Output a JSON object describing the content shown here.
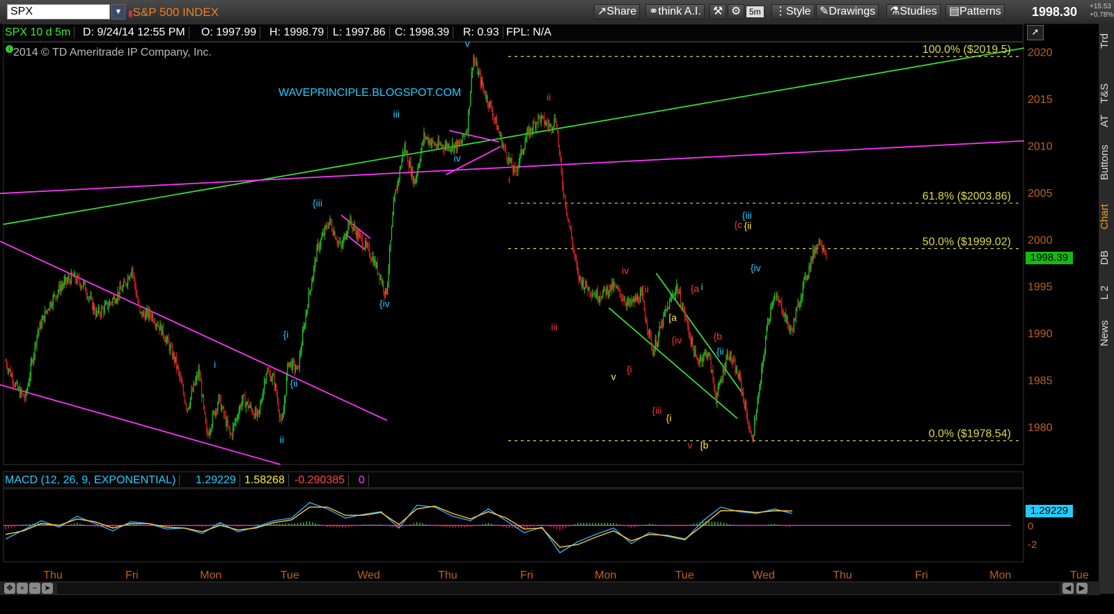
{
  "toolbar": {
    "symbol": "SPX",
    "symbol_name": "S&P 500 INDEX",
    "buttons": [
      "Share",
      "think A.I.",
      "5m",
      "Style",
      "Drawings",
      "Studies",
      "Patterns"
    ],
    "last_price": "1998.30",
    "change_abs": "+15.53",
    "change_pct": "+0.78%"
  },
  "sidebar_tabs": [
    "Trd",
    "T&S",
    "AT",
    "Buttons",
    "Chart",
    "DB",
    "L 2",
    "News"
  ],
  "infobar": {
    "label": "SPX 10 d 5m",
    "date": "D: 9/24/14 12:55 PM",
    "open": "O: 1997.99",
    "high": "H: 1998.79",
    "low": "L: 1997.86",
    "close": "C: 1998.39",
    "range": "R: 0.93",
    "fpl": "FPL: N/A"
  },
  "copyright": "2014 © TD Ameritrade IP Company, Inc.",
  "watermark": "WAVEPRINCIPLE.BLOGSPOT.COM",
  "price_badge": "1998.39",
  "macd_badge": "1.29229",
  "macd": {
    "label": "MACD (12, 26, 9, EXPONENTIAL)",
    "value": "1.29229",
    "avg": "1.58268",
    "diff": "-0.290385",
    "zero": "0"
  },
  "fib_levels": [
    {
      "label": "100.0%  ($2019.5)",
      "price": 2019.5
    },
    {
      "label": "61.8%  ($2003.86)",
      "price": 2003.86
    },
    {
      "label": "50.0%  ($1999.02)",
      "price": 1999.02
    },
    {
      "label": "0.0%  ($1978.54)",
      "price": 1978.54
    }
  ],
  "colors": {
    "up": "#22cc22",
    "down": "#dd2222",
    "green_line": "#33dd33",
    "magenta_line": "#ff33ff",
    "fib": "#dddd44",
    "cyan": "#22ccff",
    "red": "#ff3333",
    "yellow": "#ffee33",
    "axis": "#c06020"
  },
  "chart_data": {
    "type": "candlestick",
    "title": "SPX 10 d 5m",
    "ylim": [
      1976,
      2021
    ],
    "y_ticks": [
      1980,
      1985,
      1990,
      1995,
      2000,
      2005,
      2010,
      2015,
      2020
    ],
    "x_ticks": [
      "Thu",
      "Fri",
      "Mon",
      "Tue",
      "Wed",
      "Thu",
      "Fri",
      "Mon",
      "Tue",
      "Wed",
      "Thu",
      "Fri",
      "Mon",
      "Tue"
    ],
    "x_tick_session": [
      0.6,
      1.6,
      2.6,
      3.6,
      4.6,
      5.6,
      6.6,
      7.6,
      8.6,
      9.6,
      10.6,
      11.6,
      12.6,
      13.6
    ],
    "last_price": 1998.39,
    "price_path": [
      [
        0.0,
        1987
      ],
      [
        0.15,
        1984
      ],
      [
        0.25,
        1983
      ],
      [
        0.4,
        1990
      ],
      [
        0.55,
        1993
      ],
      [
        0.7,
        1995
      ],
      [
        0.85,
        1996
      ],
      [
        1.0,
        1995
      ],
      [
        1.15,
        1992
      ],
      [
        1.3,
        1993
      ],
      [
        1.5,
        1995
      ],
      [
        1.6,
        1997
      ],
      [
        1.7,
        1992
      ],
      [
        1.85,
        1992
      ],
      [
        2.0,
        1990
      ],
      [
        2.15,
        1987
      ],
      [
        2.3,
        1982
      ],
      [
        2.45,
        1986
      ],
      [
        2.55,
        1979
      ],
      [
        2.7,
        1983
      ],
      [
        2.85,
        1979
      ],
      [
        3.0,
        1983
      ],
      [
        3.2,
        1981
      ],
      [
        3.3,
        1986
      ],
      [
        3.4,
        1985
      ],
      [
        3.5,
        1980
      ],
      [
        3.58,
        1987
      ],
      [
        3.7,
        1986
      ],
      [
        3.82,
        1993
      ],
      [
        3.95,
        1999
      ],
      [
        4.1,
        2002
      ],
      [
        4.25,
        1999
      ],
      [
        4.35,
        2002
      ],
      [
        4.5,
        2000
      ],
      [
        4.65,
        1998
      ],
      [
        4.75,
        1996
      ],
      [
        4.82,
        1994
      ],
      [
        4.92,
        2004
      ],
      [
        5.05,
        2010
      ],
      [
        5.18,
        2006
      ],
      [
        5.3,
        2011
      ],
      [
        5.45,
        2010
      ],
      [
        5.6,
        2010
      ],
      [
        5.75,
        2010
      ],
      [
        5.85,
        2012
      ],
      [
        5.92,
        2019.5
      ],
      [
        6.05,
        2016
      ],
      [
        6.15,
        2014
      ],
      [
        6.3,
        2010
      ],
      [
        6.45,
        2007
      ],
      [
        6.6,
        2011
      ],
      [
        6.75,
        2013
      ],
      [
        6.9,
        2012
      ],
      [
        6.97,
        2013
      ],
      [
        7.05,
        2006
      ],
      [
        7.15,
        2001
      ],
      [
        7.25,
        1996
      ],
      [
        7.35,
        1995
      ],
      [
        7.5,
        1994
      ],
      [
        7.7,
        1995
      ],
      [
        7.9,
        1993
      ],
      [
        8.05,
        1994
      ],
      [
        8.2,
        1988
      ],
      [
        8.35,
        1992
      ],
      [
        8.5,
        1995
      ],
      [
        8.6,
        1992
      ],
      [
        8.75,
        1987
      ],
      [
        8.9,
        1988
      ],
      [
        9.0,
        1983
      ],
      [
        9.15,
        1988
      ],
      [
        9.3,
        1985
      ],
      [
        9.45,
        1978.5
      ],
      [
        9.55,
        1984
      ],
      [
        9.65,
        1991
      ],
      [
        9.72,
        1994
      ],
      [
        9.82,
        1993
      ],
      [
        9.95,
        1990
      ],
      [
        10.1,
        1995
      ],
      [
        10.25,
        1999
      ],
      [
        10.32,
        2000
      ],
      [
        10.4,
        1998.4
      ]
    ],
    "series": [
      {
        "name": "MACD",
        "color": "#33aaff",
        "values": [
          -1.5,
          -0.5,
          0.5,
          -0.2,
          1.0,
          0.2,
          -0.6,
          0.4,
          0.2,
          -0.4,
          -0.3,
          -0.9,
          0.3,
          -0.7,
          -0.2,
          0.5,
          0.8,
          2.5,
          1.8,
          0.8,
          1.2,
          1.5,
          -0.3,
          2.2,
          2.0,
          1.0,
          0.5,
          1.8,
          0.5,
          -0.8,
          -0.2,
          -3.0,
          -1.8,
          -1.0,
          -0.3,
          -2.0,
          -0.8,
          -1.2,
          -1.6,
          0.5,
          2.0,
          1.5,
          1.3,
          1.8,
          1.29
        ]
      },
      {
        "name": "Avg",
        "color": "#ffcc33",
        "values": [
          -1.0,
          -0.6,
          0.2,
          0.0,
          0.7,
          0.4,
          -0.3,
          0.2,
          0.2,
          -0.2,
          -0.3,
          -0.7,
          0.0,
          -0.5,
          -0.3,
          0.3,
          0.6,
          2.0,
          2.0,
          1.1,
          1.1,
          1.4,
          0.1,
          1.8,
          2.1,
          1.3,
          0.7,
          1.5,
          0.8,
          -0.4,
          -0.3,
          -2.4,
          -2.1,
          -1.3,
          -0.6,
          -1.7,
          -1.0,
          -1.1,
          -1.5,
          0.0,
          1.6,
          1.6,
          1.4,
          1.6,
          1.58
        ]
      }
    ],
    "macd_ylim": [
      -4,
      4
    ],
    "macd_y_ticks": [
      2,
      0,
      -2
    ],
    "wave_labels": [
      {
        "text": "v",
        "t": 5.85,
        "price": 2020.5,
        "color": "cyan"
      },
      {
        "text": "iii",
        "t": 4.95,
        "price": 2013,
        "color": "cyan"
      },
      {
        "text": "iv",
        "t": 5.72,
        "price": 2008.3,
        "color": "cyan"
      },
      {
        "text": "{iii",
        "t": 3.95,
        "price": 2003.5,
        "color": "cyan"
      },
      {
        "text": "{iv",
        "t": 4.8,
        "price": 1992.8,
        "color": "cyan"
      },
      {
        "text": "{i",
        "t": 3.55,
        "price": 1989.5,
        "color": "cyan"
      },
      {
        "text": "{ii",
        "t": 3.65,
        "price": 1984.3,
        "color": "cyan"
      },
      {
        "text": "i",
        "t": 2.65,
        "price": 1986.3,
        "color": "cyan"
      },
      {
        "text": "ii",
        "t": 3.5,
        "price": 1978.3,
        "color": "cyan"
      },
      {
        "text": "ii",
        "t": 6.88,
        "price": 2014.8,
        "color": "red"
      },
      {
        "text": "i",
        "t": 6.38,
        "price": 2006,
        "color": "red"
      },
      {
        "text": "iii",
        "t": 6.95,
        "price": 1990.3,
        "color": "red"
      },
      {
        "text": "iv",
        "t": 7.85,
        "price": 1996.3,
        "color": "red"
      },
      {
        "text": "{ii",
        "t": 8.1,
        "price": 1994.3,
        "color": "red"
      },
      {
        "text": "{i",
        "t": 7.9,
        "price": 1985.8,
        "color": "red"
      },
      {
        "text": "v",
        "t": 7.7,
        "price": 1985,
        "color": "yellow"
      },
      {
        "text": "{iii",
        "t": 8.25,
        "price": 1981.4,
        "color": "red"
      },
      {
        "text": "{i",
        "t": 8.4,
        "price": 1980.6,
        "color": "yellow"
      },
      {
        "text": "{iv",
        "t": 8.5,
        "price": 1988.9,
        "color": "red"
      },
      {
        "text": "[a",
        "t": 8.45,
        "price": 1991.3,
        "color": "yellow"
      },
      {
        "text": "v",
        "t": 8.67,
        "price": 1977.7,
        "color": "red"
      },
      {
        "text": "[b",
        "t": 8.85,
        "price": 1977.7,
        "color": "yellow"
      },
      {
        "text": "{a",
        "t": 8.73,
        "price": 1994.4,
        "color": "red"
      },
      {
        "text": "i",
        "t": 8.82,
        "price": 1994.6,
        "color": "cyan"
      },
      {
        "text": "{b",
        "t": 9.02,
        "price": 1989.3,
        "color": "red"
      },
      {
        "text": "{ii",
        "t": 9.05,
        "price": 1987.7,
        "color": "cyan"
      },
      {
        "text": "{c",
        "t": 9.28,
        "price": 2001.2,
        "color": "red"
      },
      {
        "text": "{iii",
        "t": 9.39,
        "price": 2002.2,
        "color": "cyan"
      },
      {
        "text": "{ii",
        "t": 9.4,
        "price": 2001.1,
        "color": "yellow"
      },
      {
        "text": "{iv",
        "t": 9.5,
        "price": 1996.6,
        "color": "cyan"
      }
    ]
  }
}
